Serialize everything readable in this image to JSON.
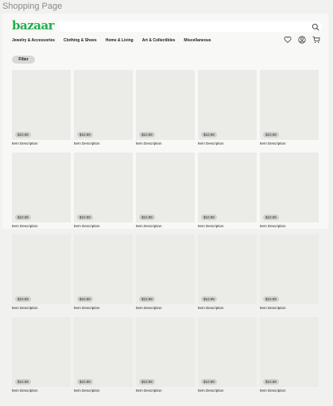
{
  "canvas_label": "Shopping Page",
  "header": {
    "logo": "bazaar",
    "brand_color": "#1db14b",
    "search": {
      "placeholder": "",
      "icon": "search-icon"
    },
    "nav": [
      "Jewelry & Accessories",
      "Clothing & Shoes",
      "Home & Living",
      "Art & Collectibles",
      "Miscellaneous"
    ],
    "icons": [
      "heart-icon",
      "user-icon",
      "cart-icon"
    ]
  },
  "filter": {
    "label": "Filter"
  },
  "products": [
    {
      "price": "$10.99",
      "description": "Item Description"
    },
    {
      "price": "$10.99",
      "description": "Item Description"
    },
    {
      "price": "$10.99",
      "description": "Item Description"
    },
    {
      "price": "$10.99",
      "description": "Item Description"
    },
    {
      "price": "$10.99",
      "description": "Item Description"
    },
    {
      "price": "$10.99",
      "description": "Item Description"
    },
    {
      "price": "$10.99",
      "description": "Item Description"
    },
    {
      "price": "$10.99",
      "description": "Item Description"
    },
    {
      "price": "$10.99",
      "description": "Item Description"
    },
    {
      "price": "$10.99",
      "description": "Item Description"
    },
    {
      "price": "$10.99",
      "description": "Item Description"
    },
    {
      "price": "$10.99",
      "description": "Item Description"
    },
    {
      "price": "$10.99",
      "description": "Item Description"
    },
    {
      "price": "$10.99",
      "description": "Item Description"
    },
    {
      "price": "$10.99",
      "description": "Item Description"
    },
    {
      "price": "$10.99",
      "description": "Item Description"
    },
    {
      "price": "$10.99",
      "description": "Item Description"
    },
    {
      "price": "$10.99",
      "description": "Item Description"
    },
    {
      "price": "$10.99",
      "description": "Item Description"
    },
    {
      "price": "$10.99",
      "description": "Item Description"
    }
  ]
}
